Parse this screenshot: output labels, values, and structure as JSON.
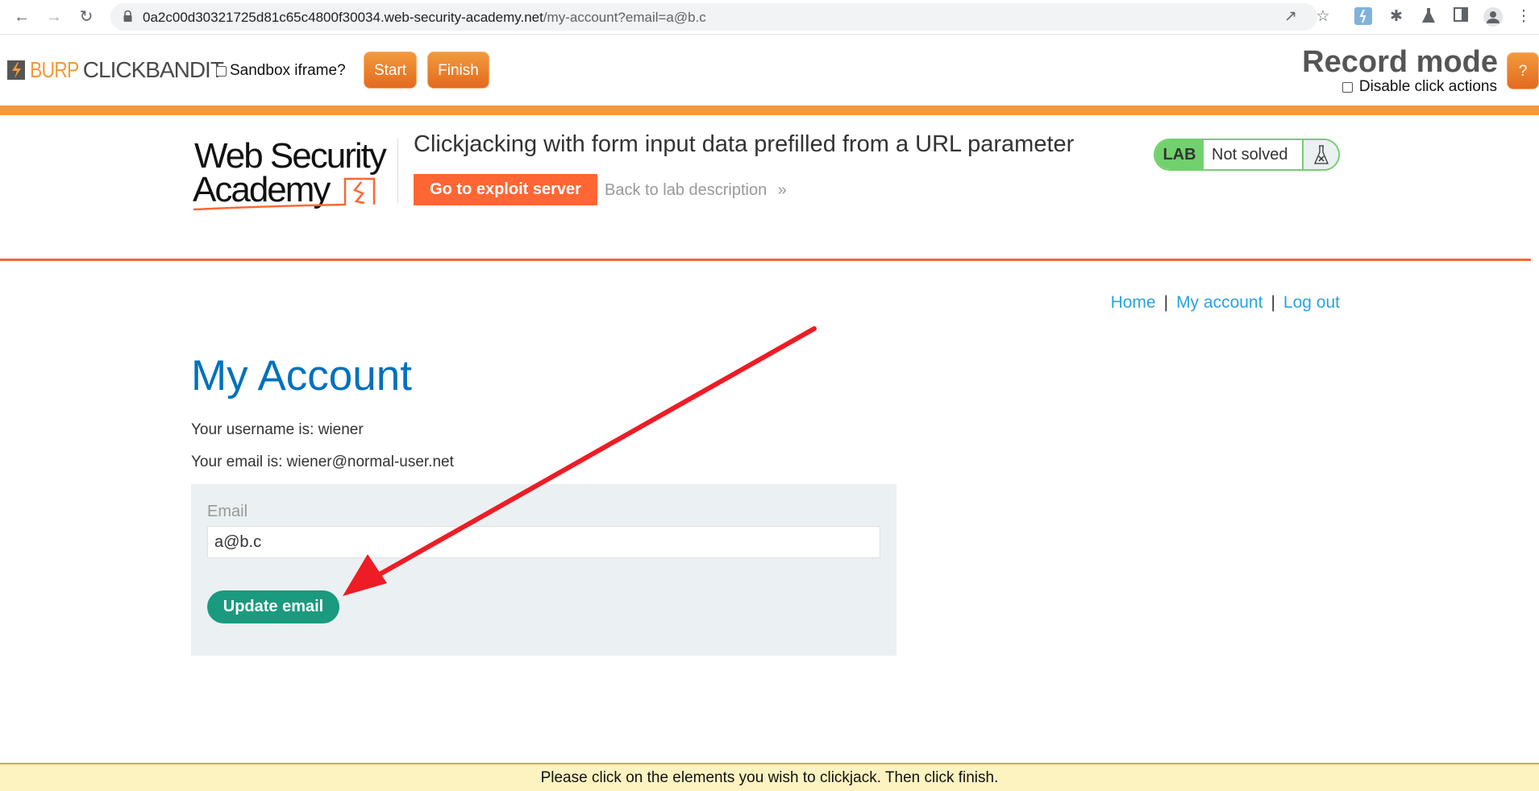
{
  "browser": {
    "url_host": "0a2c00d30321725d81c65c4800f30034.web-security-academy.net",
    "url_path": "/my-account?email=a@b.c",
    "nav_icons": [
      "back-icon",
      "forward-icon",
      "reload-icon"
    ],
    "toolbar_icons": [
      "share-icon",
      "star-icon",
      "clickbandit-extension-icon",
      "puzzle-icon",
      "flask-icon",
      "side-panel-icon",
      "profile-icon",
      "more-icon"
    ]
  },
  "clickbandit": {
    "logo_burp": "BURP",
    "logo_rest": "CLICKBANDIT",
    "sandbox_label": "Sandbox iframe?",
    "sandbox_checked": false,
    "start_label": "Start",
    "finish_label": "Finish",
    "mode_title": "Record mode",
    "disable_label": "Disable click actions",
    "disable_checked": false,
    "help_label": "?",
    "accent_color": "#f39a3c"
  },
  "lab": {
    "logo_line1": "Web Security",
    "logo_line2": "Academy",
    "title": "Clickjacking with form input data prefilled from a URL parameter",
    "exploit_label": "Go to exploit server",
    "back_label": "Back to lab description",
    "back_chevron": "»",
    "badge_label": "LAB",
    "status": "Not solved",
    "status_color": "#70d16d",
    "accent_color": "#ff6633"
  },
  "nav": {
    "links": [
      "Home",
      "My account",
      "Log out"
    ],
    "separator": "|"
  },
  "account": {
    "heading": "My Account",
    "username_line": "Your username is: wiener",
    "email_line": "Your email is: wiener@normal-user.net",
    "email_label": "Email",
    "email_value": "a@b.c",
    "update_label": "Update email",
    "button_color": "#1a9a7e"
  },
  "annotation": {
    "type": "arrow",
    "color": "#ee1c25",
    "points_to": "update-email-button"
  },
  "banner": {
    "text": "Please click on the elements you wish to clickjack. Then click finish."
  }
}
